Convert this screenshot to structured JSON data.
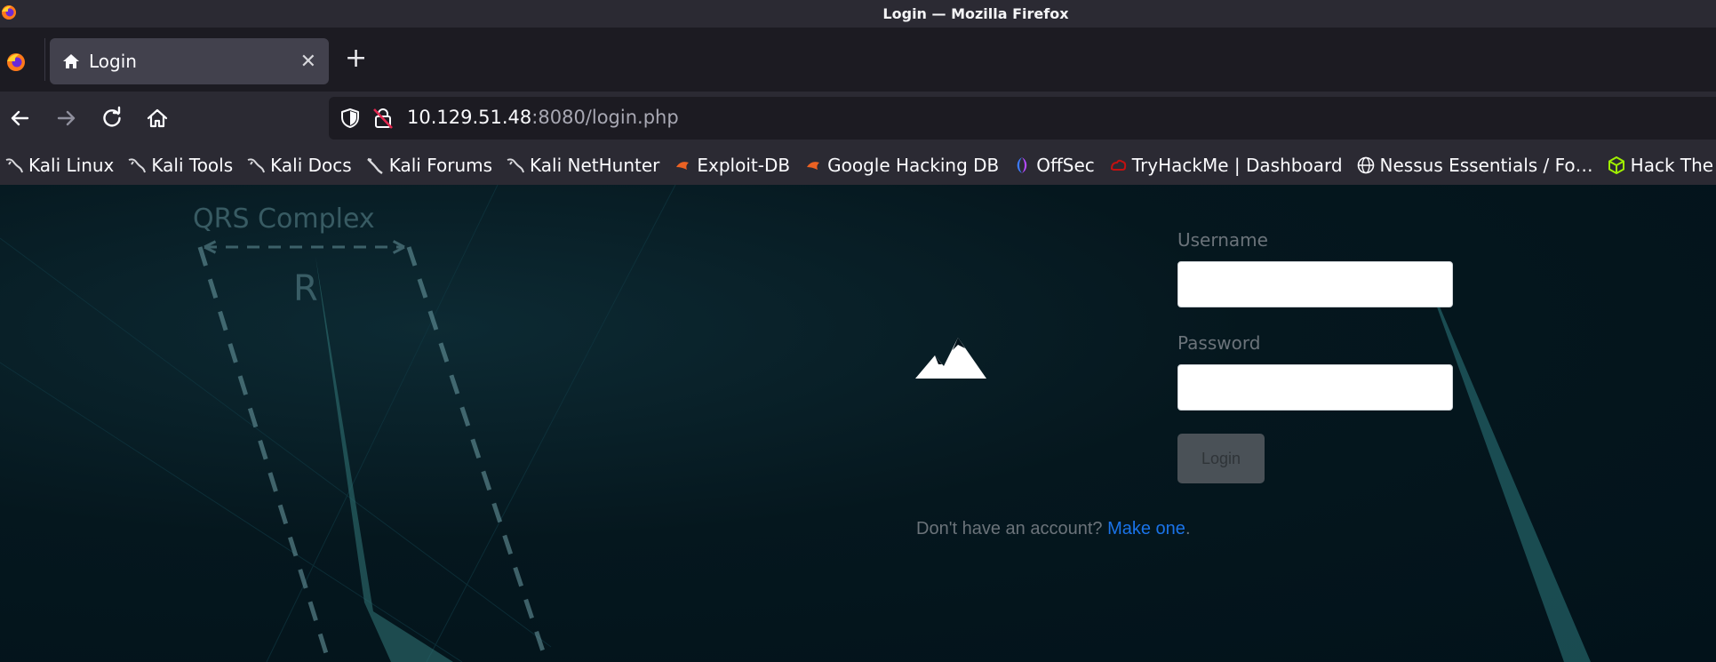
{
  "window": {
    "title": "Login — Mozilla Firefox"
  },
  "tab": {
    "label": "Login",
    "close_symbol": "✕",
    "new_tab_symbol": "+"
  },
  "navbar": {
    "url_host": "10.129.51.48",
    "url_rest": ":8080/login.php"
  },
  "bookmarks": [
    {
      "label": "Kali Linux",
      "icon": "kali-dragon-icon"
    },
    {
      "label": "Kali Tools",
      "icon": "kali-dragon-icon"
    },
    {
      "label": "Kali Docs",
      "icon": "kali-dragon-icon"
    },
    {
      "label": "Kali Forums",
      "icon": "kali-dragon-icon"
    },
    {
      "label": "Kali NetHunter",
      "icon": "kali-dragon-icon"
    },
    {
      "label": "Exploit-DB",
      "icon": "exploit-db-icon"
    },
    {
      "label": "Google Hacking DB",
      "icon": "exploit-db-icon"
    },
    {
      "label": "OffSec",
      "icon": "offsec-icon"
    },
    {
      "label": "TryHackMe | Dashboard",
      "icon": "tryhackme-icon"
    },
    {
      "label": "Nessus Essentials / Fo…",
      "icon": "globe-icon"
    },
    {
      "label": "Hack The Box",
      "icon": "hackthebox-icon"
    }
  ],
  "background": {
    "diagram_title": "QRS Complex",
    "diagram_letter": "R"
  },
  "login": {
    "username_label": "Username",
    "username_value": "",
    "password_label": "Password",
    "password_value": "",
    "button_label": "Login",
    "signup_prompt": "Don't have an account?",
    "signup_link": "Make one",
    "signup_suffix": "."
  },
  "colors": {
    "accent_link": "#1a73e8",
    "page_bg": "#02121a",
    "chrome_bg": "#2b2a33"
  }
}
